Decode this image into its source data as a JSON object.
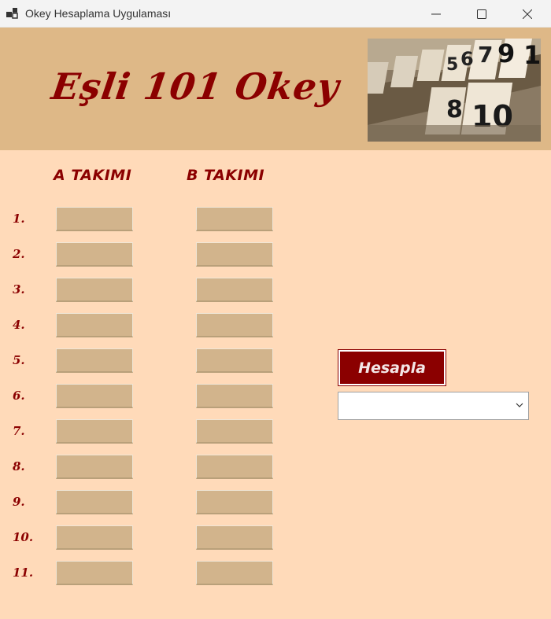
{
  "window": {
    "title": "Okey Hesaplama Uygulaması"
  },
  "header": {
    "title": "Eşli 101 Okey"
  },
  "columns": {
    "a": "A TAKIMI",
    "b": "B TAKIMI"
  },
  "rows": [
    "1.",
    "2.",
    "3.",
    "4.",
    "5.",
    "6.",
    "7.",
    "8.",
    "9.",
    "10.",
    "11."
  ],
  "a_values": [
    "",
    "",
    "",
    "",
    "",
    "",
    "",
    "",
    "",
    "",
    ""
  ],
  "b_values": [
    "",
    "",
    "",
    "",
    "",
    "",
    "",
    "",
    "",
    "",
    ""
  ],
  "actions": {
    "calculate_label": "Hesapla"
  },
  "result_select": {
    "selected": ""
  },
  "colors": {
    "accent": "#8b0000",
    "background": "#ffdab9",
    "header": "#deb887",
    "field": "#d2b48c"
  }
}
